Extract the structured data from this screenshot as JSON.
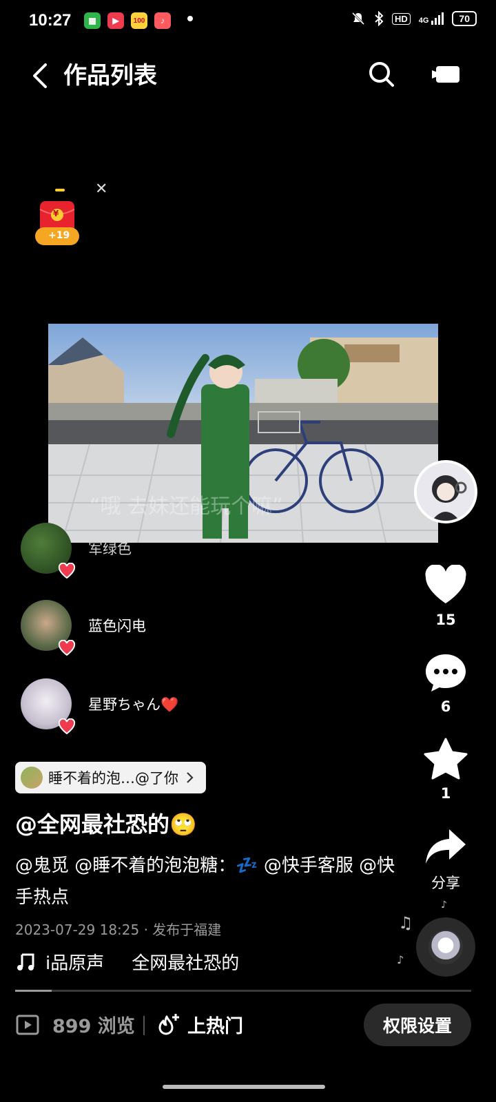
{
  "status_bar": {
    "time": "10:27",
    "network": "4G",
    "hd_badge": "HD",
    "battery": "70",
    "app_icons": [
      "grid-app-icon",
      "video-app-icon",
      "hundred-app-icon",
      "music-app-icon"
    ]
  },
  "nav": {
    "title": "作品列表",
    "icons": [
      "back-icon",
      "search-icon",
      "camera-icon"
    ]
  },
  "red_packet": {
    "amount": "+19",
    "symbol": "¥"
  },
  "likers": [
    {
      "name": "军绿色"
    },
    {
      "name": "蓝色闪电"
    },
    {
      "name": "星野ちゃん❤️"
    }
  ],
  "actions": {
    "likes": "15",
    "comments": "6",
    "favorites": "1",
    "share_label": "分享"
  },
  "caption": {
    "mention_chip": "睡不着的泡…@了你",
    "author": "@全网最社恐的🙄",
    "description": "@鬼觅 @睡不着的泡泡糖：💤 @快手客服 @快手热点",
    "date_location": "2023-07-29 18:25 · 发布于福建",
    "music_part1": "ⅰ品原声",
    "music_part2": "全网最社恐的"
  },
  "progress": {
    "fraction": 0.08
  },
  "bottom_bar": {
    "views": "899 浏览",
    "hot_label": "上热门",
    "permission_label": "权限设置"
  },
  "colors": {
    "accent_red": "#ef3b4f",
    "background": "#000000"
  }
}
